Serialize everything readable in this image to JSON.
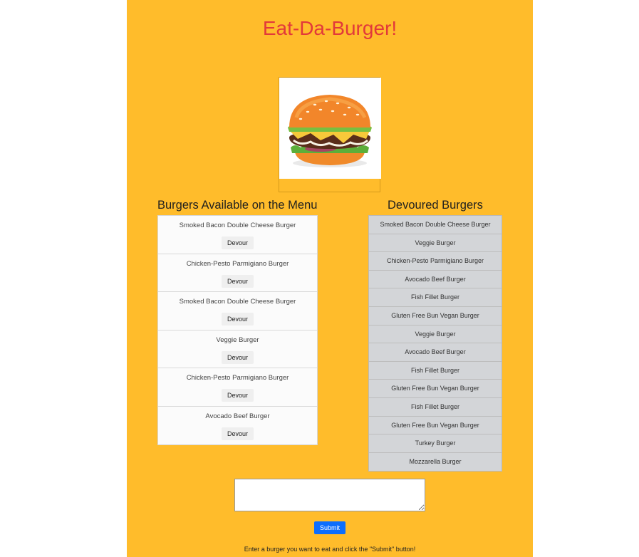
{
  "header": {
    "title": "Eat-Da-Burger!"
  },
  "hero_image": {
    "icon": "burger-image"
  },
  "menu": {
    "heading": "Burgers Available on the Menu",
    "items": [
      {
        "name": "Smoked Bacon Double Cheese Burger",
        "button": "Devour"
      },
      {
        "name": "Chicken-Pesto Parmigiano Burger",
        "button": "Devour"
      },
      {
        "name": "Smoked Bacon Double Cheese Burger",
        "button": "Devour"
      },
      {
        "name": "Veggie Burger",
        "button": "Devour"
      },
      {
        "name": "Chicken-Pesto Parmigiano Burger",
        "button": "Devour"
      },
      {
        "name": "Avocado Beef Burger",
        "button": "Devour"
      }
    ]
  },
  "devoured": {
    "heading": "Devoured Burgers",
    "items": [
      "Smoked Bacon Double Cheese Burger",
      "Veggie Burger",
      "Chicken-Pesto Parmigiano Burger",
      "Avocado Beef Burger",
      "Fish Fillet Burger",
      "Gluten Free Bun Vegan Burger",
      "Veggie Burger",
      "Avocado Beef Burger",
      "Fish Fillet Burger",
      "Gluten Free Bun Vegan Burger",
      "Fish Fillet Burger",
      "Gluten Free Bun Vegan Burger",
      "Turkey Burger",
      "Mozzarella Burger"
    ]
  },
  "form": {
    "textarea_value": "",
    "submit_label": "Submit",
    "hint": "Enter a burger you want to eat and click the \"Submit\" button!"
  },
  "colors": {
    "panel_bg": "#ffbc2b",
    "title": "#e2393a",
    "submit": "#0d6efd"
  }
}
